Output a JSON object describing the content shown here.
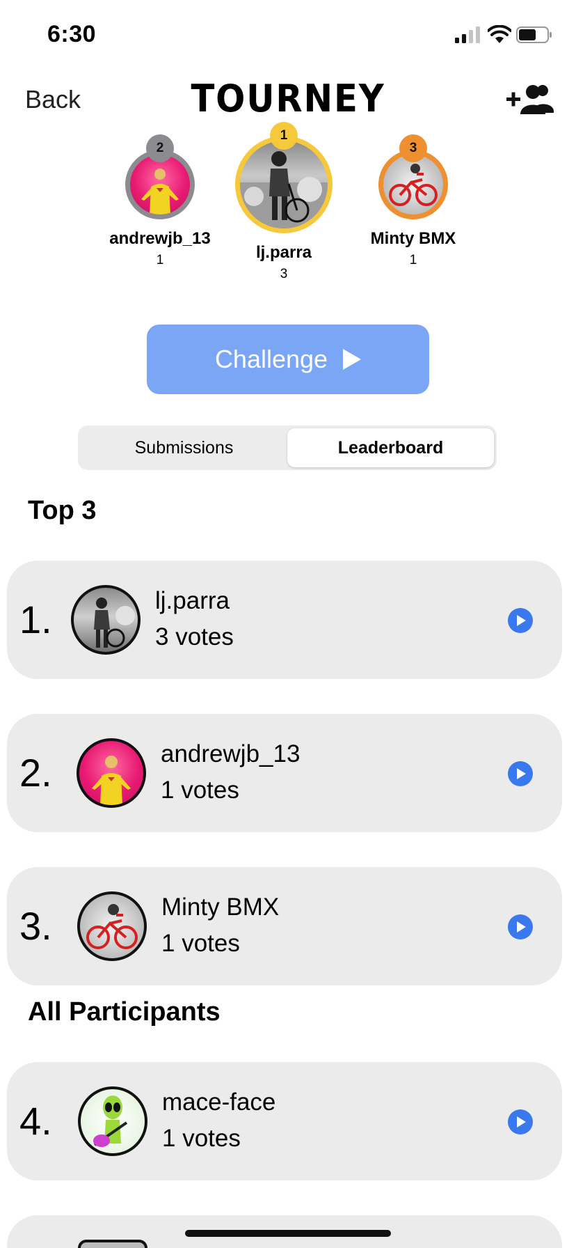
{
  "status_bar": {
    "time": "6:30"
  },
  "nav": {
    "back_label": "Back",
    "logo_text": "TOURNEY",
    "add_friend_icon": "person-add-icon"
  },
  "podium": [
    {
      "rank": "1",
      "name": "lj.parra",
      "votes": "3",
      "ring_color": "#f6c83c",
      "avatar": "bmx-rider-grayscale"
    },
    {
      "rank": "2",
      "name": "andrewjb_13",
      "votes": "1",
      "ring_color": "#8c8c90",
      "avatar": "yellow-suit-pink-background"
    },
    {
      "rank": "3",
      "name": "Minty BMX",
      "votes": "1",
      "ring_color": "#ee8f30",
      "avatar": "red-bmx-bike"
    }
  ],
  "challenge": {
    "label": "Challenge"
  },
  "tabs": [
    {
      "label": "Submissions",
      "active": false
    },
    {
      "label": "Leaderboard",
      "active": true
    }
  ],
  "sections": {
    "top3": "Top 3",
    "all": "All Participants"
  },
  "leaderboard": [
    {
      "rank": "1.",
      "name": "lj.parra",
      "votes": "3 votes",
      "avatar": "bmx-rider-grayscale"
    },
    {
      "rank": "2.",
      "name": "andrewjb_13",
      "votes": "1 votes",
      "avatar": "yellow-suit-pink-background"
    },
    {
      "rank": "3.",
      "name": "Minty BMX",
      "votes": "1 votes",
      "avatar": "red-bmx-bike"
    },
    {
      "rank": "4.",
      "name": "mace-face",
      "votes": "1 votes",
      "avatar": "alien-guitar"
    }
  ],
  "colors": {
    "accent": "#3a78ee",
    "challenge_bg": "#7ba5f5",
    "row_bg": "#ebebeb"
  }
}
